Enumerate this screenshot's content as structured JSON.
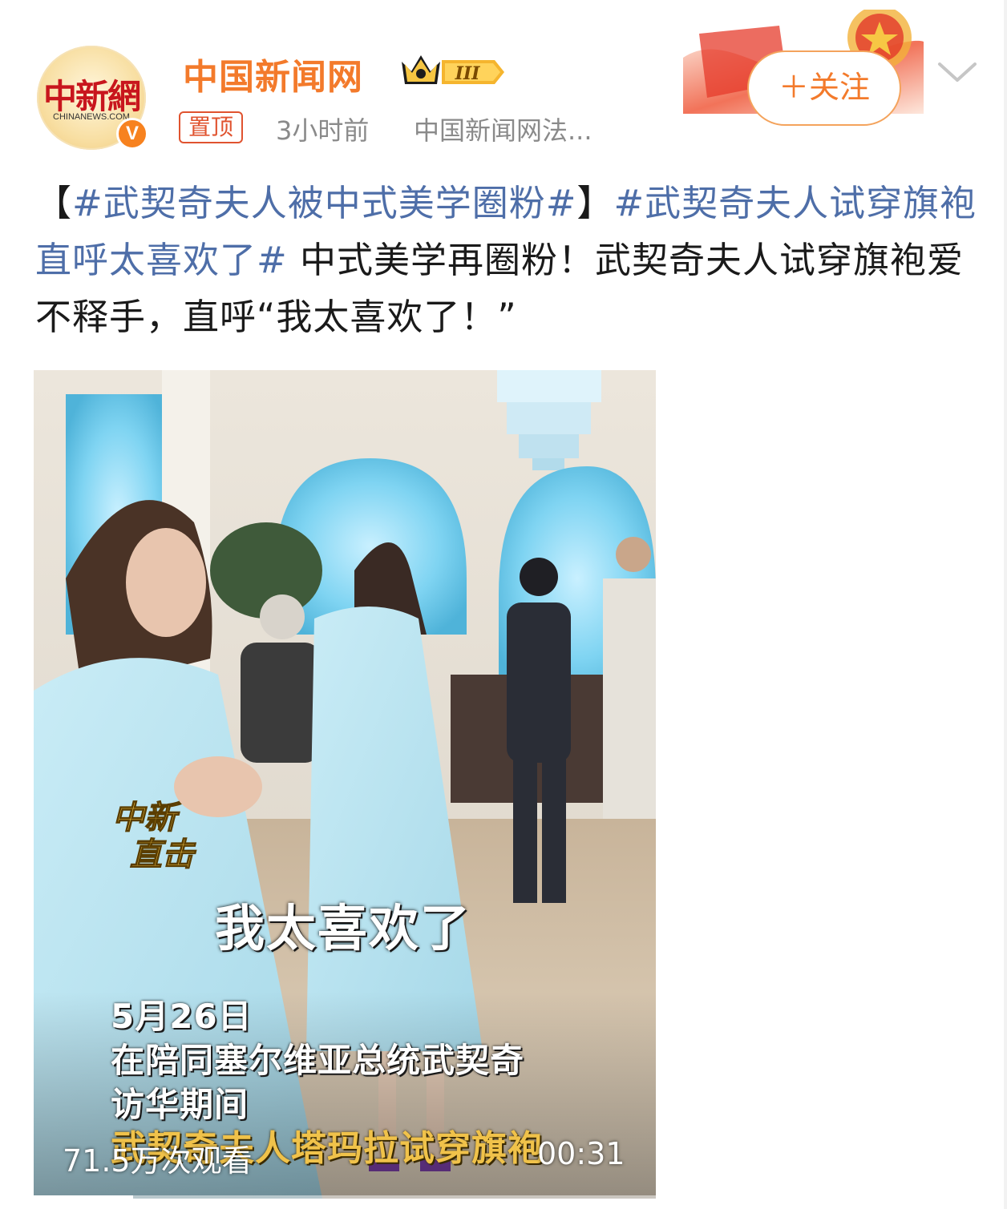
{
  "header": {
    "account_name": "中国新闻网",
    "avatar_logo": "中新網",
    "avatar_sub": "CHINANEWS.COM",
    "verified_mark": "V",
    "vip_level": "III",
    "pin_label": "置顶",
    "time_ago": "3小时前",
    "source": "中国新闻网法...",
    "follow_label": "＋关注"
  },
  "post": {
    "bracket_open": "【",
    "tag1": "#武契奇夫人被中式美学圈粉#",
    "bracket_close": "】",
    "tag2": "#武契奇夫人试穿旗袍直呼太喜欢了#",
    "body": " 中式美学再圈粉！武契奇夫人试穿旗袍爱不释手，直呼“我太喜欢了！”"
  },
  "video": {
    "watermark_line1": "中新",
    "watermark_line2": "直击",
    "subtitle_main": "我太喜欢了",
    "caption_date": "5月26日",
    "caption_line1": "在陪同塞尔维亚总统武契奇",
    "caption_line2": "访华期间",
    "caption_line3": "武契奇夫人塔玛拉试穿旗袍",
    "views": "71.5万次观看",
    "duration": "00:31",
    "progress": 0.16
  },
  "colors": {
    "account_orange": "#f37a2b",
    "hashtag_blue": "#4e6ea8",
    "pin_red": "#e0532f",
    "meta_gray": "#8a8a8a"
  },
  "icons": [
    "crown-icon",
    "verified-v-icon",
    "chevron-down-icon",
    "play-progress-bar"
  ]
}
